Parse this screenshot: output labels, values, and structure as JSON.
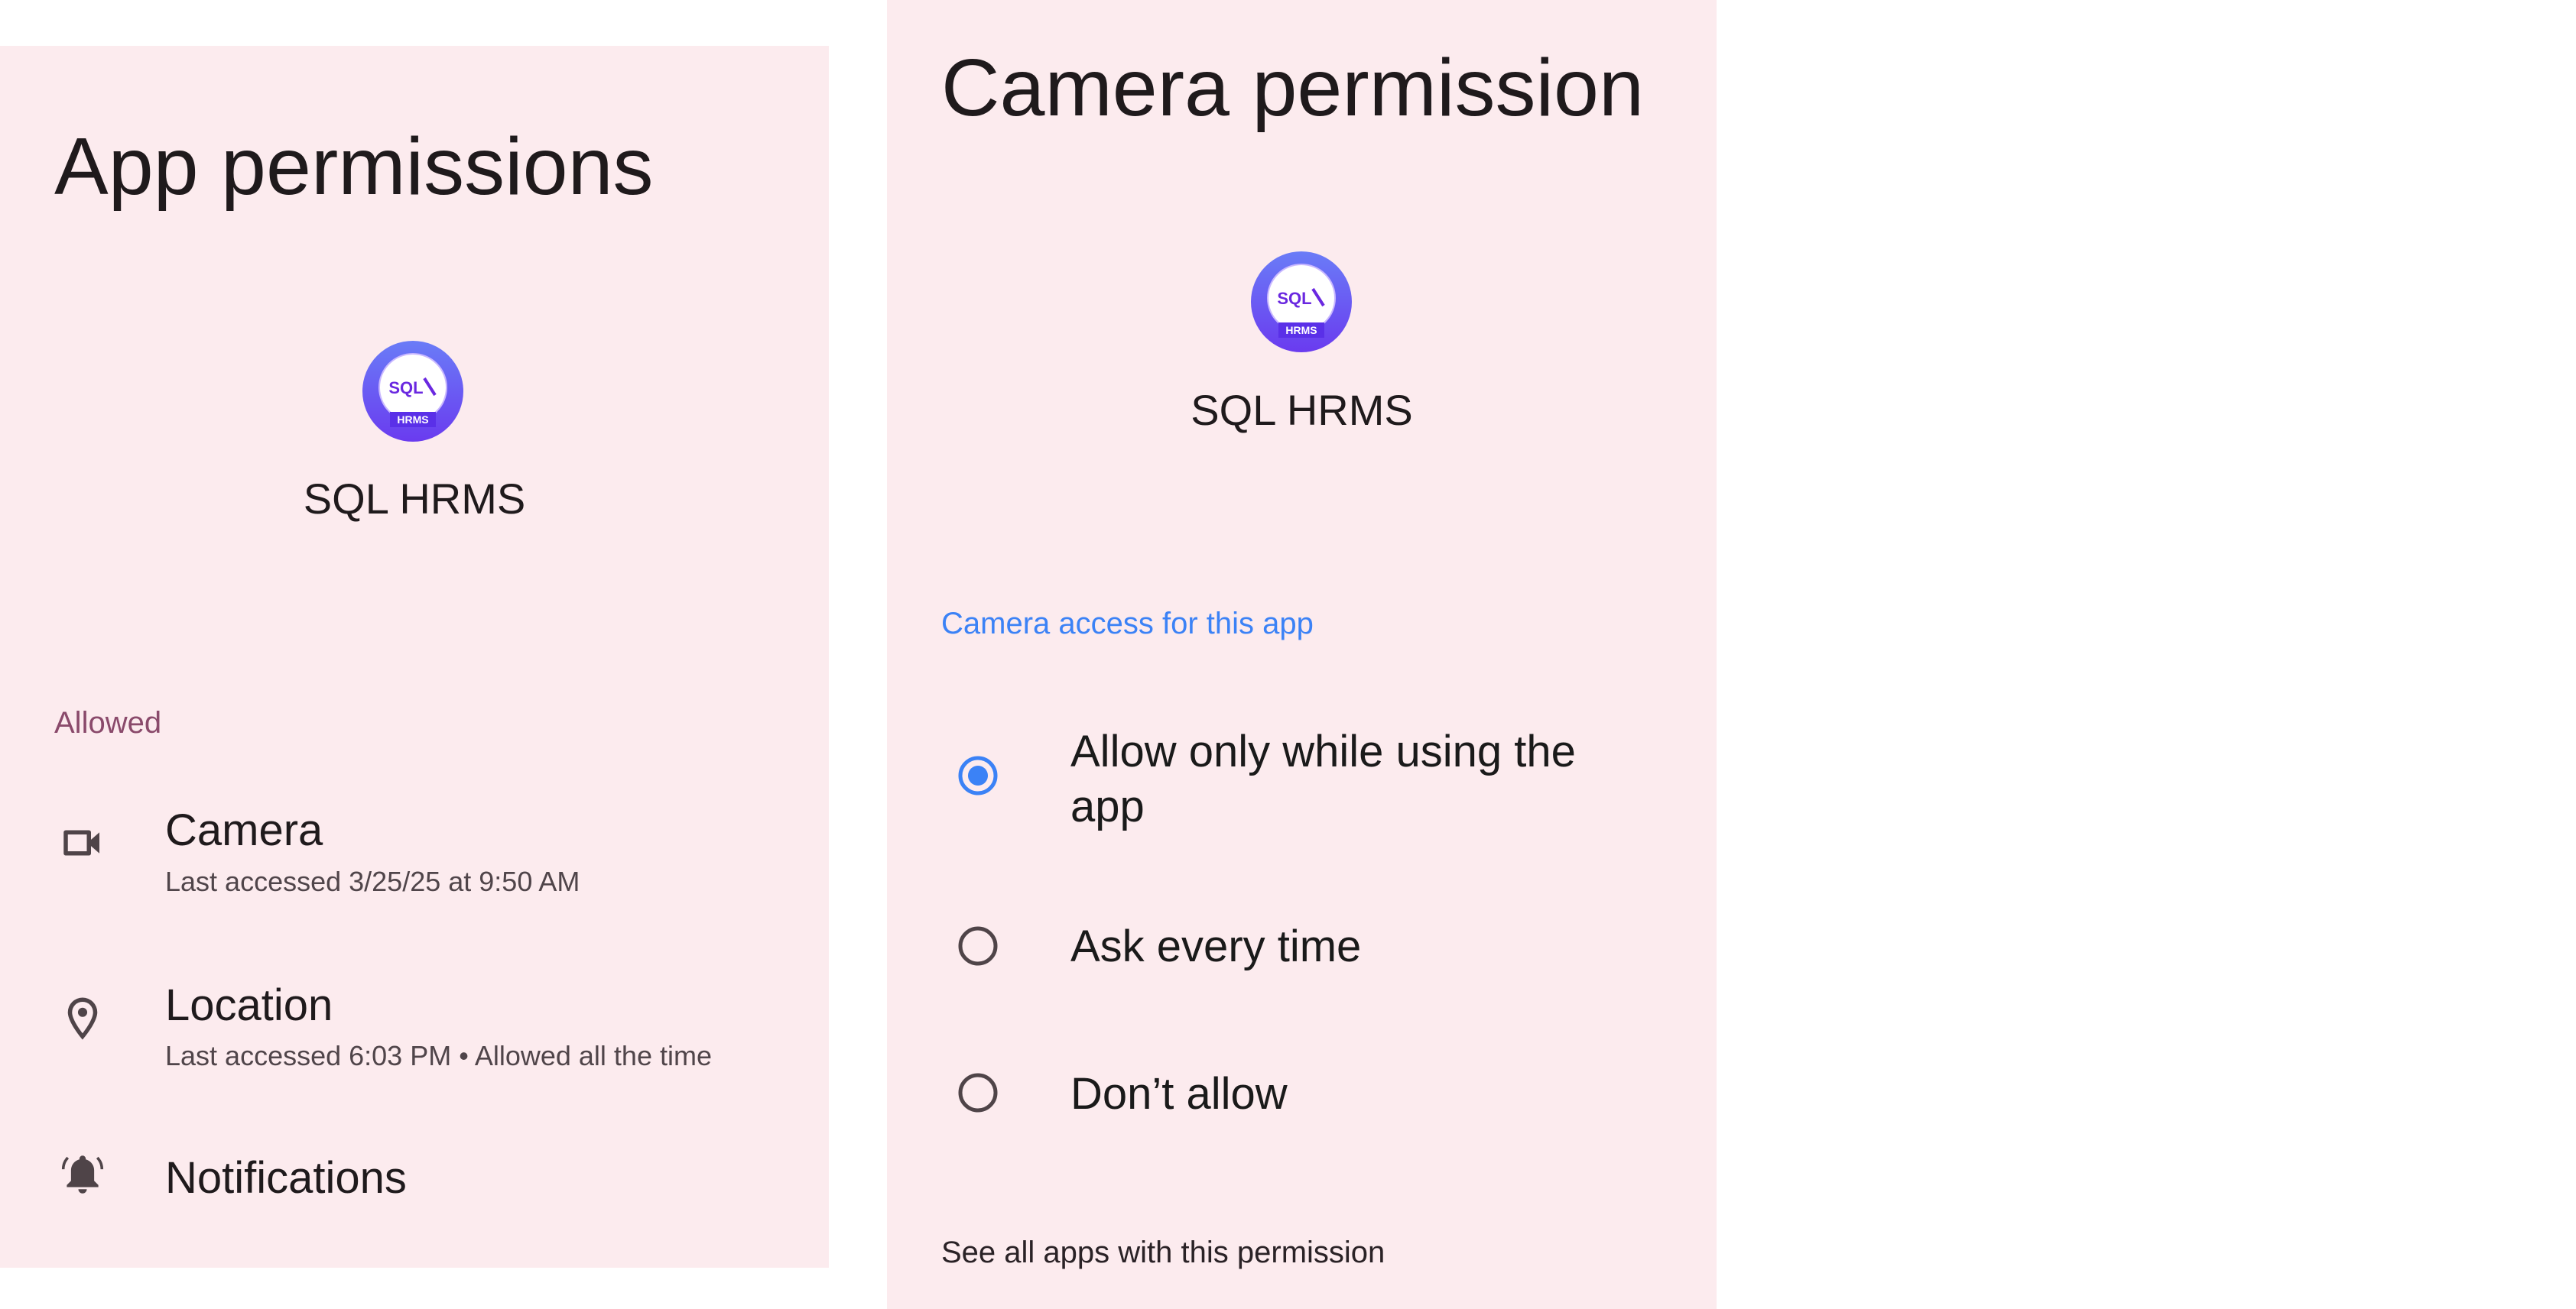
{
  "app_permissions": {
    "title": "App permissions",
    "app_name": "SQL HRMS",
    "app_logo_text": {
      "top": "SQL",
      "bottom": "HRMS"
    },
    "section_label": "Allowed",
    "items": [
      {
        "icon": "videocam-icon",
        "title": "Camera",
        "subtitle": "Last accessed 3/25/25 at 9:50 AM"
      },
      {
        "icon": "location-pin-icon",
        "title": "Location",
        "subtitle": "Last accessed 6:03 PM • Allowed all the time"
      },
      {
        "icon": "bell-ringing-icon",
        "title": "Notifications"
      }
    ]
  },
  "camera_permission": {
    "title": "Camera permission",
    "app_name": "SQL HRMS",
    "section_label": "Camera access for this app",
    "options": [
      {
        "line1": "Allow only while using the",
        "line2": "app",
        "selected": true
      },
      {
        "label": "Ask every time",
        "selected": false
      },
      {
        "label": "Don’t allow",
        "selected": false
      }
    ],
    "see_all_link": "See all apps with this permission"
  },
  "colors": {
    "panel_background": "#fcebee",
    "accent_blue": "#3b82f6",
    "allowed_label": "#8a4a6b",
    "text": "#1f1a1c"
  }
}
